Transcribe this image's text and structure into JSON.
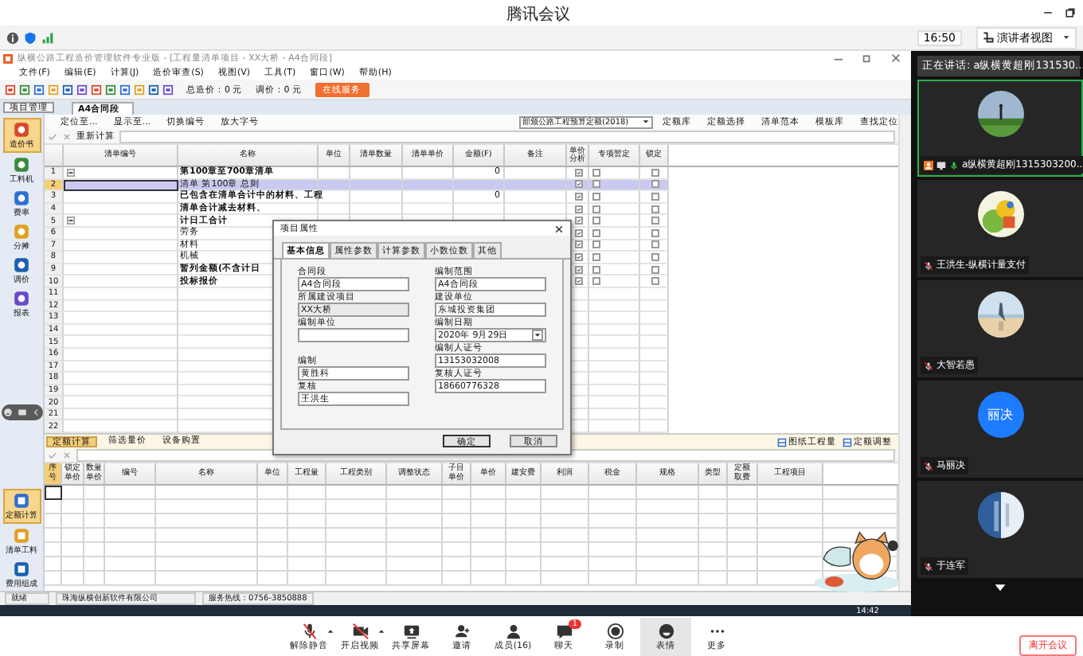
{
  "meeting": {
    "title": "腾讯会议",
    "time": "16:50",
    "view_button": "演讲者视图"
  },
  "app": {
    "title": "纵横公路工程造价管理软件专业版 - [工程量清单项目 - XX大桥 - A4合同段]",
    "menu": [
      "文件(F)",
      "编辑(E)",
      "计算(J)",
      "造价审查(S)",
      "视图(V)",
      "工具(T)",
      "窗口(W)",
      "帮助(H)"
    ],
    "total_cost": "总造价：0 元",
    "adjust_cost": "调价：0 元",
    "orange_button": "在线服务",
    "project_tab": "项目管理",
    "doc_tab": "A4合同段",
    "tools": [
      "定位至...",
      "显示至...",
      "切换编号",
      "放大字号"
    ],
    "quota_select": "部颁公路工程预算定额(2018)",
    "quota_tools": [
      "定额库",
      "定额选择",
      "清单范本",
      "模板库",
      "查找定位"
    ],
    "recalc": "重新计算"
  },
  "sidebar": {
    "top": [
      {
        "label": "造价书",
        "selected": true
      },
      {
        "label": "工料机",
        "selected": false
      },
      {
        "label": "费率",
        "selected": false
      },
      {
        "label": "分摊",
        "selected": false
      },
      {
        "label": "调价",
        "selected": false
      },
      {
        "label": "报表",
        "selected": false
      }
    ],
    "bottom": [
      {
        "label": "定额计算",
        "selected": true
      },
      {
        "label": "清单工料",
        "selected": false
      },
      {
        "label": "费用组成",
        "selected": false
      }
    ]
  },
  "table": {
    "columns": [
      "清单编号",
      "名称",
      "单位",
      "清单数量",
      "清单单价",
      "金额(F)",
      "备注",
      "单价分析",
      "专项暂定",
      "锁定"
    ],
    "rows": [
      {
        "num": "1",
        "name": "第100章至700章清单",
        "amount": "0",
        "bold": true,
        "selected": false,
        "analysis": true,
        "special": false,
        "locked": false,
        "expanded": true,
        "children": [
          {
            "num": "2",
            "name": "清单 第100章  总则",
            "bold": false,
            "selected": true,
            "analysis": true,
            "special": false,
            "locked": false
          },
          {
            "num": "3",
            "name": "已包含在清单合计中的材料、工程",
            "amount": "0",
            "bold": true,
            "selected": false,
            "analysis": true,
            "special": false,
            "locked": false
          },
          {
            "num": "4",
            "name": "清单合计减去材料、",
            "bold": true,
            "selected": false,
            "analysis": true,
            "special": false,
            "locked": false
          }
        ]
      },
      {
        "num": "5",
        "name": "计日工合计",
        "bold": true,
        "selected": false,
        "analysis": true,
        "special": false,
        "locked": false,
        "expanded": true,
        "children": [
          {
            "num": "6",
            "name": "劳务",
            "bold": false,
            "selected": false,
            "analysis": true,
            "special": false,
            "locked": false
          },
          {
            "num": "7",
            "name": "材料",
            "bold": false,
            "selected": false,
            "analysis": true,
            "special": false,
            "locked": false
          },
          {
            "num": "8",
            "name": "机械",
            "bold": false,
            "selected": false,
            "analysis": true,
            "special": false,
            "locked": false
          }
        ]
      },
      {
        "num": "9",
        "name": "暂列金额(不含计日",
        "bold": true,
        "selected": false,
        "analysis": true,
        "special": false,
        "locked": false
      },
      {
        "num": "10",
        "name": "投标报价",
        "bold": true,
        "selected": false,
        "analysis": true,
        "special": false,
        "locked": false
      },
      {
        "num": "11",
        "kind": "blank"
      },
      {
        "num": "12",
        "kind": "blank"
      },
      {
        "num": "13",
        "kind": "blank"
      },
      {
        "num": "14",
        "kind": "blank"
      },
      {
        "num": "15",
        "kind": "blank"
      },
      {
        "num": "16",
        "kind": "blank"
      },
      {
        "num": "17",
        "kind": "blank"
      },
      {
        "num": "18",
        "kind": "blank"
      },
      {
        "num": "19",
        "kind": "blank"
      },
      {
        "num": "20",
        "kind": "blank"
      },
      {
        "num": "21",
        "kind": "blank"
      },
      {
        "num": "22",
        "kind": "blank"
      }
    ]
  },
  "dialog": {
    "title": "项目属性",
    "tabs": [
      {
        "label": "基本信息",
        "selected": true
      },
      {
        "label": "属性参数",
        "selected": false
      },
      {
        "label": "计算参数",
        "selected": false
      },
      {
        "label": "小数位数",
        "selected": false
      },
      {
        "label": "其他",
        "selected": false
      }
    ],
    "left": [
      {
        "label": "合同段",
        "value": "A4合同段"
      },
      {
        "label": "所属建设项目",
        "value": "XX大桥",
        "kind": "readonly"
      },
      {
        "label": "编制单位"
      },
      {
        "label": "编制",
        "value": "黄胜科"
      },
      {
        "label": "复核",
        "value": "王洪生"
      }
    ],
    "right": [
      {
        "label": "编制范围",
        "value": "A4合同段"
      },
      {
        "label": "建设单位",
        "value": "东城投资集团"
      },
      {
        "label": "编制日期",
        "value": "2020年 9月29日",
        "kind": "date"
      },
      {
        "label": "编制人证号",
        "value": "13153032008"
      },
      {
        "label": "复核人证号",
        "value": "18660776328"
      }
    ],
    "buttons": [
      "确定",
      "取消"
    ]
  },
  "lower": {
    "tabs": [
      {
        "label": "定额计算",
        "selected": true
      },
      {
        "label": "筛选量价",
        "selected": false
      },
      {
        "label": "设备购置",
        "selected": false
      }
    ],
    "tools": [
      "图纸工程量",
      "定额调整"
    ],
    "columns": [
      "序号",
      "锁定单价",
      "数量单价",
      "编号",
      "名称",
      "单位",
      "工程量",
      "工程类别",
      "调整状态",
      "子目单价",
      "单价",
      "建安费",
      "利润",
      "税金",
      "规格",
      "类型",
      "定额取费",
      "工程项目"
    ]
  },
  "status_bar": [
    "就绪",
    "珠海纵横创新软件有限公司",
    "服务热线：0756-3850888"
  ],
  "taskbar": {
    "time": "14:42"
  },
  "participants": {
    "speaking": "正在讲话: a纵横黄超刚131530...",
    "list": [
      {
        "name": "a纵横黄超刚1315303200...",
        "host": true,
        "muted": false,
        "kind": "picture"
      },
      {
        "name": "王洪生-纵横计量支付",
        "host": false,
        "muted": true,
        "kind": "picture"
      },
      {
        "name": "大智若愚",
        "host": false,
        "muted": true,
        "kind": "picture"
      },
      {
        "name": "马丽决",
        "host": false,
        "muted": true,
        "kind": "initials",
        "initials": "丽决"
      },
      {
        "name": "于连军",
        "host": false,
        "muted": true,
        "kind": "picture"
      }
    ]
  },
  "toolbar": {
    "buttons": [
      {
        "label": "解除静音",
        "kind": "mic",
        "menu": true,
        "selected": false
      },
      {
        "label": "开启视频",
        "kind": "camera",
        "menu": true,
        "selected": false
      },
      {
        "label": "共享屏幕",
        "kind": "share",
        "selected": false
      },
      {
        "label": "邀请",
        "kind": "invite",
        "selected": false
      },
      {
        "label": "成员(16)",
        "kind": "members",
        "selected": false
      },
      {
        "label": "聊天",
        "kind": "chat",
        "badge": "1",
        "selected": false
      },
      {
        "label": "录制",
        "kind": "record",
        "selected": false
      },
      {
        "label": "表情",
        "kind": "emoji",
        "selected": true
      },
      {
        "label": "更多",
        "kind": "more",
        "selected": false
      }
    ],
    "leave": "离开会议"
  }
}
